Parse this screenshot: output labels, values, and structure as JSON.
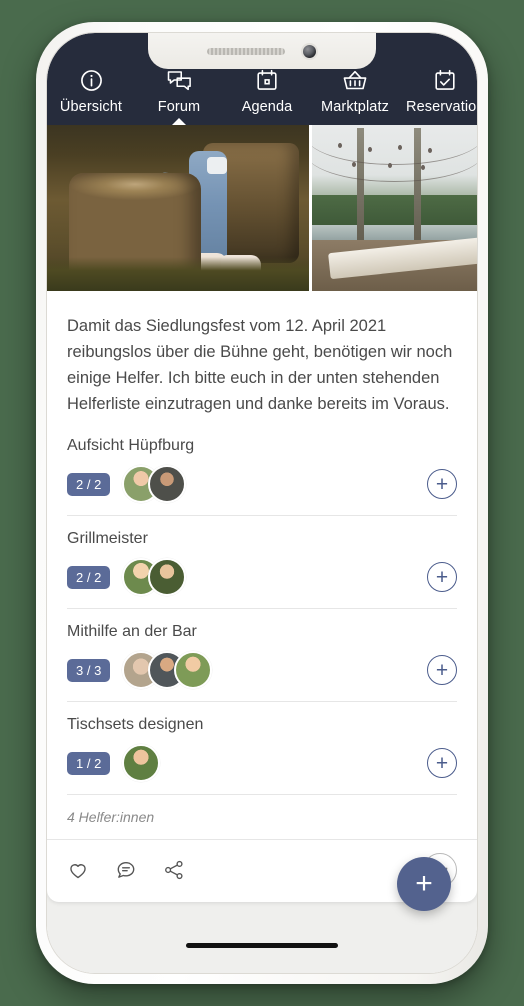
{
  "nav": {
    "items": [
      {
        "label": "Übersicht",
        "icon": "info-circle-icon",
        "active": false
      },
      {
        "label": "Forum",
        "icon": "chat-bubbles-icon",
        "active": true
      },
      {
        "label": "Agenda",
        "icon": "calendar-icon",
        "active": false
      },
      {
        "label": "Marktplatz",
        "icon": "basket-icon",
        "active": false
      },
      {
        "label": "Reservation",
        "icon": "calendar-check-icon",
        "active": false
      }
    ]
  },
  "post": {
    "body": "Damit das Siedlungsfest vom 12. April 2021 reibungslos über die Bühne geht, benötigen wir noch einige Helfer. Ich bitte euch in der unten stehenden Helferliste einzutragen und danke bereits im Voraus.",
    "helpers_summary": "4 Helfer:innen"
  },
  "tasks": [
    {
      "title": "Aufsicht Hüpfburg",
      "badge": "2 / 2",
      "avatar_count": 2,
      "add_label": "+"
    },
    {
      "title": "Grillmeister",
      "badge": "2 / 2",
      "avatar_count": 2,
      "add_label": "+"
    },
    {
      "title": "Mithilfe an der Bar",
      "badge": "3 / 3",
      "avatar_count": 3,
      "add_label": "+"
    },
    {
      "title": "Tischsets designen",
      "badge": "1 / 2",
      "avatar_count": 1,
      "add_label": "+"
    }
  ],
  "actions": {
    "like": "like-icon",
    "comment": "comment-icon",
    "share": "share-icon",
    "more_label": "···"
  },
  "fab": {
    "label": "+"
  },
  "colors": {
    "nav_background": "#262c3c",
    "accent": "#53628e",
    "badge": "#5b6b98",
    "page_background": "#efefed",
    "card": "#ffffff",
    "outside": "#4a6b4d"
  }
}
